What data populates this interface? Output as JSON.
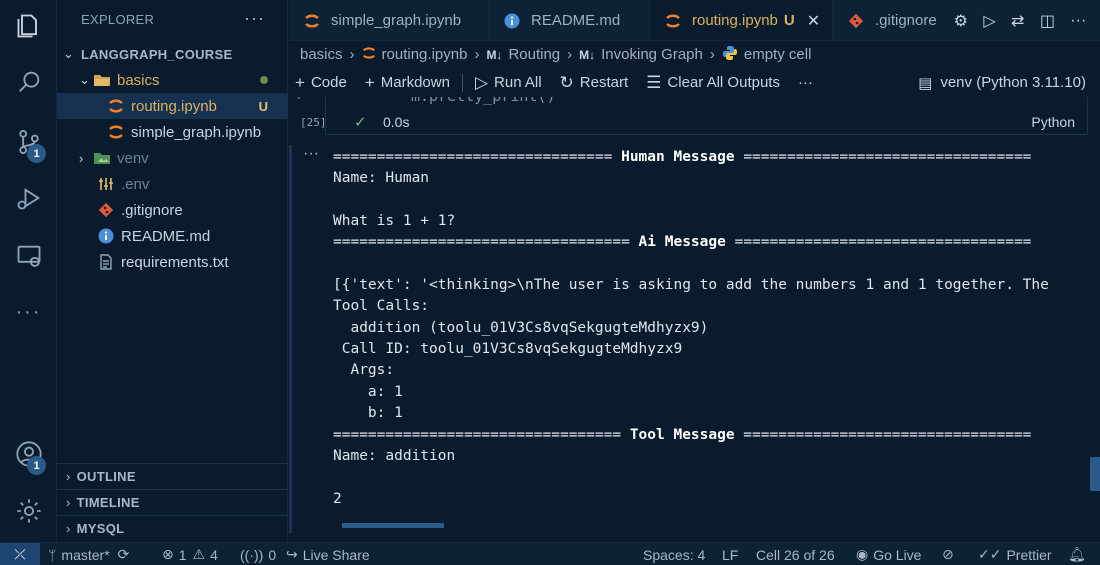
{
  "sidebar": {
    "title": "EXPLORER",
    "more": "···",
    "tree": [
      {
        "label": "LANGGRAPH_COURSE",
        "kind": "root"
      },
      {
        "label": "basics",
        "kind": "folder"
      },
      {
        "label": "routing.ipynb",
        "kind": "notebook",
        "badge": "U"
      },
      {
        "label": "simple_graph.ipynb",
        "kind": "notebook"
      },
      {
        "label": "venv",
        "kind": "folder"
      },
      {
        "label": ".env",
        "kind": "env"
      },
      {
        "label": ".gitignore",
        "kind": "git"
      },
      {
        "label": "README.md",
        "kind": "info"
      },
      {
        "label": "requirements.txt",
        "kind": "text"
      }
    ],
    "sections": {
      "outline": "OUTLINE",
      "timeline": "TIMELINE",
      "mysql": "MYSQL"
    }
  },
  "activity": {
    "scm_badge": "1",
    "account_badge": "1"
  },
  "tabs": [
    {
      "label": "simple_graph.ipynb"
    },
    {
      "label": "README.md"
    },
    {
      "label": "routing.ipynb",
      "badge": "U"
    },
    {
      "label": ".gitignore"
    }
  ],
  "breadcrumb": {
    "folder": "basics",
    "file": "routing.ipynb",
    "md_icon": "M↓",
    "section1": "Routing",
    "section2": "Invoking Graph",
    "cell": "empty cell"
  },
  "toolbar": {
    "code": "Code",
    "markdown": "Markdown",
    "run_all": "Run All",
    "restart": "Restart",
    "clear_outputs": "Clear All Outputs",
    "more": "···",
    "kernel": "venv (Python 3.11.10)"
  },
  "cell": {
    "prev_code": "m.pretty_print()",
    "exec_count": "[25]",
    "time": "0.0s",
    "language": "Python",
    "output_more": "···",
    "output_lines": [
      "================================ Human Message =================================",
      "Name: Human",
      "",
      "What is 1 + 1?",
      "================================== Ai Message ==================================",
      "",
      "[{'text': '<thinking>\\nThe user is asking to add the numbers 1 and 1 together. The",
      "Tool Calls:",
      "  addition (toolu_01V3Cs8vqSekgugteMdhyzx9)",
      " Call ID: toolu_01V3Cs8vqSekgugteMdhyzx9",
      "  Args:",
      "    a: 1",
      "    b: 1",
      "================================= Tool Message =================================",
      "Name: addition",
      "",
      "2"
    ]
  },
  "status": {
    "branch": "master*",
    "errors": "1",
    "warnings": "4",
    "ports": "0",
    "live_share": "Live Share",
    "spaces": "Spaces: 4",
    "eol": "LF",
    "cell_pos": "Cell 26 of 26",
    "go_live": "Go Live",
    "prettier": "Prettier"
  },
  "colors": {
    "accent": "#2c5a87",
    "modified": "#d9b15e",
    "background": "#0b1b2e"
  }
}
